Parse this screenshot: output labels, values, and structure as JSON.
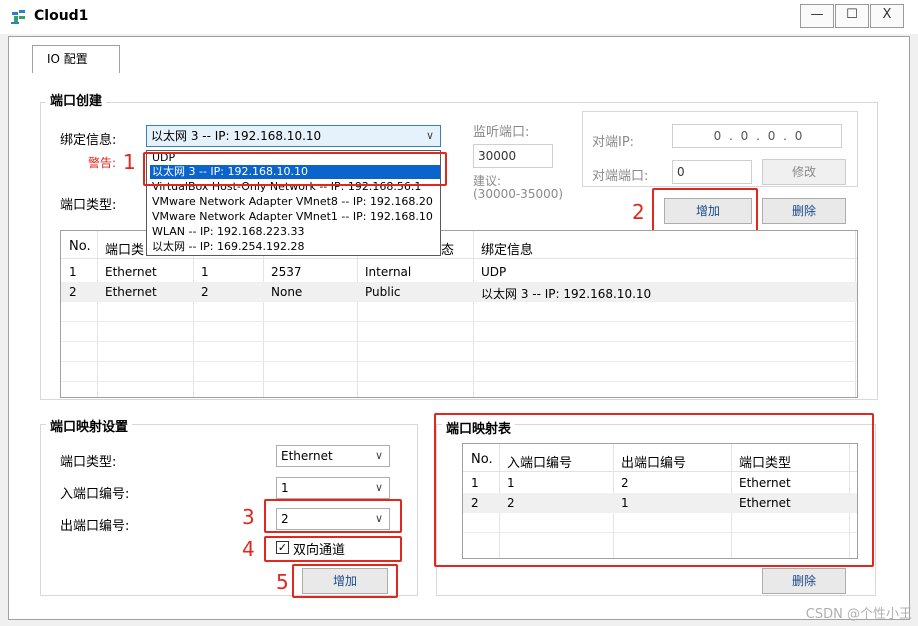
{
  "window": {
    "title": "Cloud1",
    "minimize": "—",
    "maximize": "☐",
    "close": "X"
  },
  "tab": {
    "label": "IO 配置"
  },
  "port_create": {
    "group_title": "端口创建",
    "binding_label": "绑定信息:",
    "binding_value": "以太网 3 -- IP: 192.168.10.10",
    "warning_label": "警告:",
    "port_type_label": "端口类型:",
    "listen_port_label": "监听端口:",
    "listen_port_value": "30000",
    "suggest_label": "建议:",
    "suggest_range": "(30000-35000)",
    "peer_ip_label": "对端IP:",
    "peer_ip_value": "0 . 0 . 0 . 0",
    "peer_port_label": "对端端口:",
    "peer_port_value": "0",
    "modify_button": "修改",
    "add_button": "增加",
    "delete_button": "删除",
    "dropdown_options": [
      "UDP",
      "以太网 3 -- IP: 192.168.10.10",
      "VirtualBox Host-Only Network -- IP: 192.168.56.1",
      "VMware Network Adapter VMnet8 -- IP: 192.168.20",
      "VMware Network Adapter VMnet1 -- IP: 192.168.10",
      "WLAN -- IP: 192.168.223.33",
      "以太网 -- IP: 169.254.192.28"
    ],
    "dropdown_selected": 1,
    "table": {
      "columns": [
        "No.",
        "端口类",
        "",
        "",
        "态",
        "绑定信息"
      ],
      "rows": [
        [
          "1",
          "Ethernet",
          "1",
          "2537",
          "Internal",
          "UDP"
        ],
        [
          "2",
          "Ethernet",
          "2",
          "None",
          "Public",
          "以太网 3 -- IP: 192.168.10.10"
        ]
      ]
    }
  },
  "mapping_settings": {
    "group_title": "端口映射设置",
    "port_type_label": "端口类型:",
    "port_type_value": "Ethernet",
    "in_port_label": "入端口编号:",
    "in_port_value": "1",
    "out_port_label": "出端口编号:",
    "out_port_value": "2",
    "bidirectional_label": "双向通道",
    "bidirectional_checked": true,
    "checkmark": "✓",
    "add_button": "增加"
  },
  "mapping_table": {
    "group_title": "端口映射表",
    "columns": [
      "No.",
      "入端口编号",
      "出端口编号",
      "端口类型"
    ],
    "rows": [
      [
        "1",
        "1",
        "2",
        "Ethernet"
      ],
      [
        "2",
        "2",
        "1",
        "Ethernet"
      ]
    ],
    "delete_button": "删除"
  },
  "annotations": [
    "1",
    "2",
    "3",
    "4",
    "5"
  ],
  "watermark": "CSDN @个性小王",
  "colors": {
    "highlight_red": "#e0281e",
    "selection_blue": "#0a64cc"
  }
}
